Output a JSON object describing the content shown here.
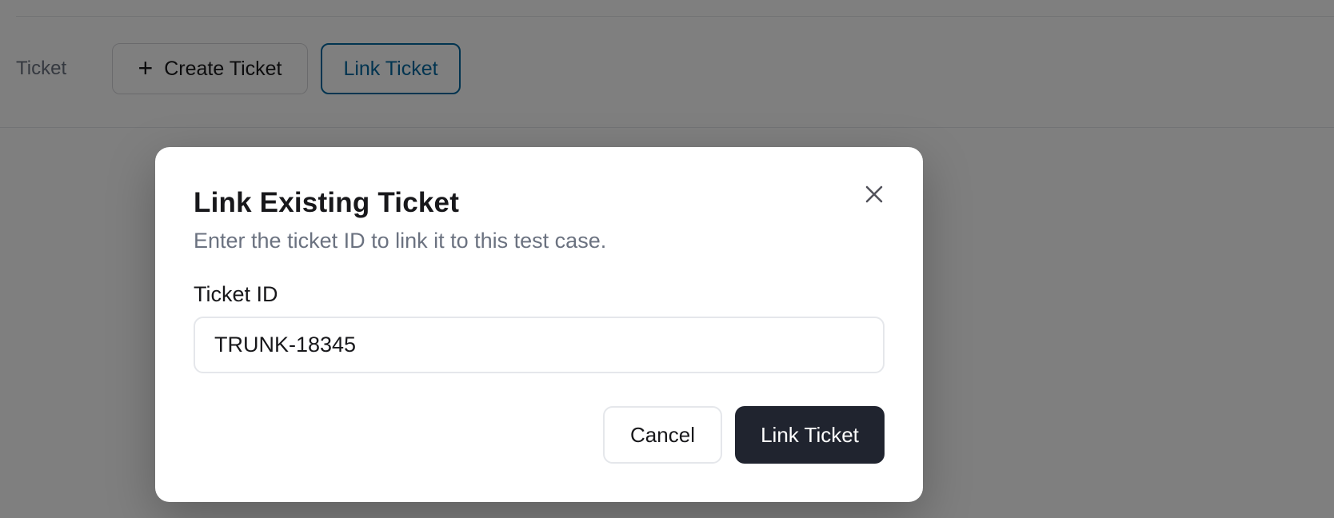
{
  "background": {
    "section_label": "Ticket",
    "create_ticket_label": "Create Ticket",
    "link_ticket_label": "Link Ticket"
  },
  "modal": {
    "title": "Link Existing Ticket",
    "description": "Enter the ticket ID to link it to this test case.",
    "field_label": "Ticket ID",
    "field_value": "TRUNK-18345",
    "cancel_label": "Cancel",
    "submit_label": "Link Ticket"
  },
  "icons": {
    "create": "plus-icon",
    "close": "close-icon"
  },
  "colors": {
    "overlay": "rgba(0,0,0,0.5)",
    "primary_button": "#20242f",
    "link_outline": "#0369a1",
    "muted_text": "#6b7280"
  }
}
